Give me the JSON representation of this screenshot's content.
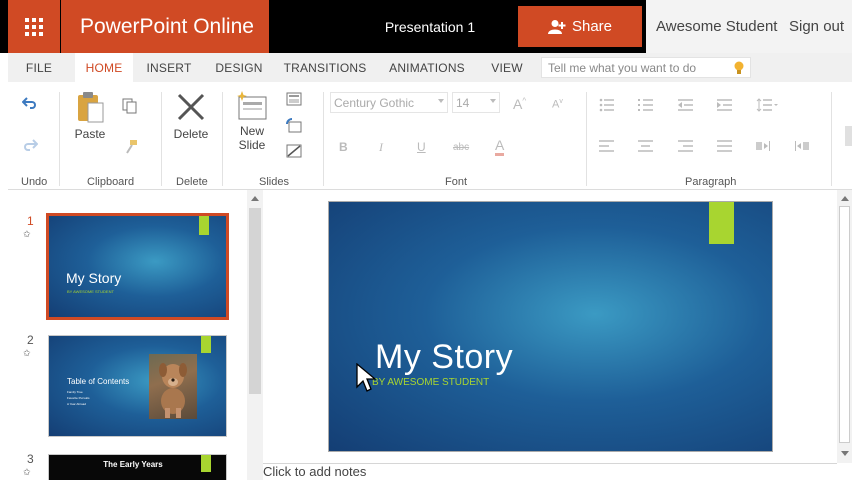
{
  "header": {
    "app_name": "PowerPoint Online",
    "document_title": "Presentation 1",
    "share_label": "Share",
    "user_name": "Awesome Student",
    "sign_out_label": "Sign out"
  },
  "tabs": [
    {
      "label": "FILE",
      "active": false
    },
    {
      "label": "HOME",
      "active": true
    },
    {
      "label": "INSERT",
      "active": false
    },
    {
      "label": "DESIGN",
      "active": false
    },
    {
      "label": "TRANSITIONS",
      "active": false
    },
    {
      "label": "ANIMATIONS",
      "active": false
    },
    {
      "label": "VIEW",
      "active": false
    }
  ],
  "tell_me": {
    "placeholder": "Tell me what you want to do"
  },
  "ribbon": {
    "groups": {
      "undo": "Undo",
      "clipboard": "Clipboard",
      "delete": "Delete",
      "slides": "Slides",
      "font": "Font",
      "paragraph": "Paragraph"
    },
    "buttons": {
      "paste": "Paste",
      "delete": "Delete",
      "new_slide_line1": "New",
      "new_slide_line2": "Slide"
    },
    "font_name": "Century Gothic",
    "font_size": "14",
    "font_format": {
      "bold": "B",
      "italic": "I",
      "underline": "U",
      "strikethrough": "abc",
      "font_color": "A"
    }
  },
  "slides": [
    {
      "number": "1",
      "title": "My Story",
      "subtitle": "BY AWESOME STUDENT",
      "selected": true
    },
    {
      "number": "2",
      "title": "Table of Contents",
      "bullets": [
        "Family Tree",
        "Favorite Pursuits",
        "A Year Abroad"
      ],
      "selected": false
    },
    {
      "number": "3",
      "title": "The Early Years",
      "selected": false
    }
  ],
  "main_slide": {
    "title": "My Story",
    "subtitle": "BY AWESOME STUDENT"
  },
  "notes": {
    "placeholder": "Click to add notes"
  },
  "colors": {
    "accent": "#d04a24",
    "lime": "#a8d530",
    "slide_blue": "#1e5f98"
  }
}
